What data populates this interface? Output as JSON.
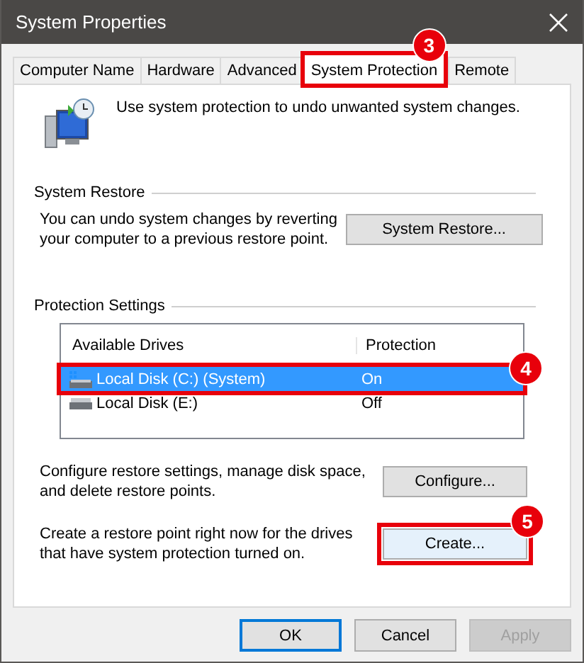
{
  "window": {
    "title": "System Properties"
  },
  "tabs": [
    {
      "label": "Computer Name",
      "selected": false,
      "highlighted": false
    },
    {
      "label": "Hardware",
      "selected": false,
      "highlighted": false
    },
    {
      "label": "Advanced",
      "selected": false,
      "highlighted": false
    },
    {
      "label": "System Protection",
      "selected": true,
      "highlighted": true,
      "badge": "3"
    },
    {
      "label": "Remote",
      "selected": false,
      "highlighted": false
    }
  ],
  "intro": "Use system protection to undo unwanted system changes.",
  "system_restore": {
    "title": "System Restore",
    "text": "You can undo system changes by reverting your computer to a previous restore point.",
    "button": {
      "label": "System Restore...",
      "highlighted": false
    }
  },
  "protection_settings": {
    "title": "Protection Settings",
    "columns": [
      "Available Drives",
      "Protection"
    ],
    "drives": [
      {
        "kind": "system",
        "name": "Local Disk (C:) (System)",
        "protection": "On",
        "selected": true,
        "highlighted": true,
        "badge": "4"
      },
      {
        "kind": "data",
        "name": "Local Disk (E:)",
        "protection": "Off",
        "selected": false,
        "highlighted": false
      }
    ],
    "actions": [
      {
        "text": "Configure restore settings, manage disk space, and delete restore points.",
        "button": {
          "label": "Configure...",
          "highlighted": false
        }
      },
      {
        "text": "Create a restore point right now for the drives that have system protection turned on.",
        "button": {
          "label": "Create...",
          "highlighted": true,
          "badge": "5"
        }
      }
    ]
  },
  "buttons": [
    {
      "label": "OK",
      "default": true,
      "disabled": false
    },
    {
      "label": "Cancel",
      "default": false,
      "disabled": false
    },
    {
      "label": "Apply",
      "default": false,
      "disabled": true
    }
  ]
}
